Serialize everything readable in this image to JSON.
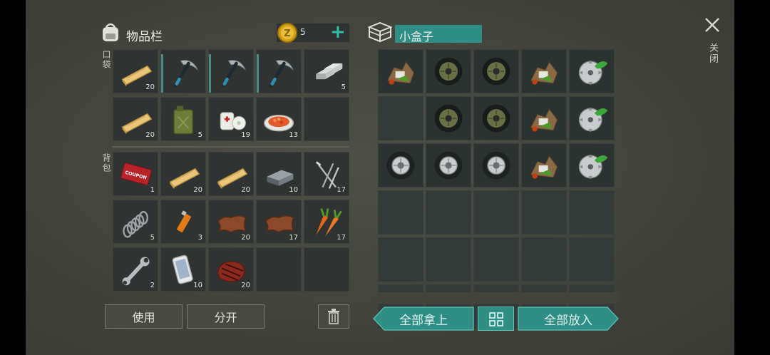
{
  "inventory": {
    "title": "物品栏",
    "coins": "5",
    "pocket_label": "口袋",
    "backpack_label": "背包",
    "pocket": [
      {
        "icon": "wood-plank-icon",
        "count": "20"
      },
      {
        "icon": "pickaxe-icon",
        "count": ""
      },
      {
        "icon": "pickaxe-icon",
        "count": ""
      },
      {
        "icon": "pickaxe-icon",
        "count": ""
      },
      {
        "icon": "iron-bar-icon",
        "count": "5"
      },
      {
        "icon": "wood-plank-icon",
        "count": "20"
      },
      {
        "icon": "jerrycan-icon",
        "count": "5"
      },
      {
        "icon": "bandage-icon",
        "count": "19"
      },
      {
        "icon": "food-plate-icon",
        "count": "13"
      },
      {
        "icon": "",
        "count": ""
      }
    ],
    "backpack": [
      {
        "icon": "coupon-icon",
        "count": "1"
      },
      {
        "icon": "wood-plank-icon",
        "count": "20"
      },
      {
        "icon": "wood-plank-icon",
        "count": "20"
      },
      {
        "icon": "steel-bar-icon",
        "count": "10"
      },
      {
        "icon": "nails-icon",
        "count": "17"
      },
      {
        "icon": "spring-icon",
        "count": "5"
      },
      {
        "icon": "lighter-icon",
        "count": "3"
      },
      {
        "icon": "leather-icon",
        "count": "20"
      },
      {
        "icon": "leather-icon",
        "count": "17"
      },
      {
        "icon": "carrot-icon",
        "count": "17"
      },
      {
        "icon": "wrench-icon",
        "count": "2"
      },
      {
        "icon": "smartphone-icon",
        "count": "10"
      },
      {
        "icon": "steak-icon",
        "count": "20"
      },
      {
        "icon": "",
        "count": ""
      },
      {
        "icon": "",
        "count": ""
      }
    ],
    "use_label": "使用",
    "split_label": "分开"
  },
  "container": {
    "title": "小盒子",
    "slots": [
      "scrap-icon",
      "tire-icon",
      "tire-icon",
      "scrap-icon",
      "sawblade-icon",
      "",
      "tire-icon",
      "tire-icon",
      "scrap-icon",
      "sawblade-icon",
      "wheel-icon",
      "wheel-icon",
      "wheel-icon",
      "scrap-icon",
      "sawblade-icon",
      "",
      "",
      "",
      "",
      "",
      "",
      "",
      "",
      "",
      "",
      "",
      "",
      "",
      "",
      ""
    ],
    "take_all_label": "全部拿上",
    "put_all_label": "全部放入"
  },
  "close_label": "关闭",
  "colors": {
    "accent": "#2f8f86",
    "coin": "#d4a017",
    "plus": "#2fbfa8"
  }
}
